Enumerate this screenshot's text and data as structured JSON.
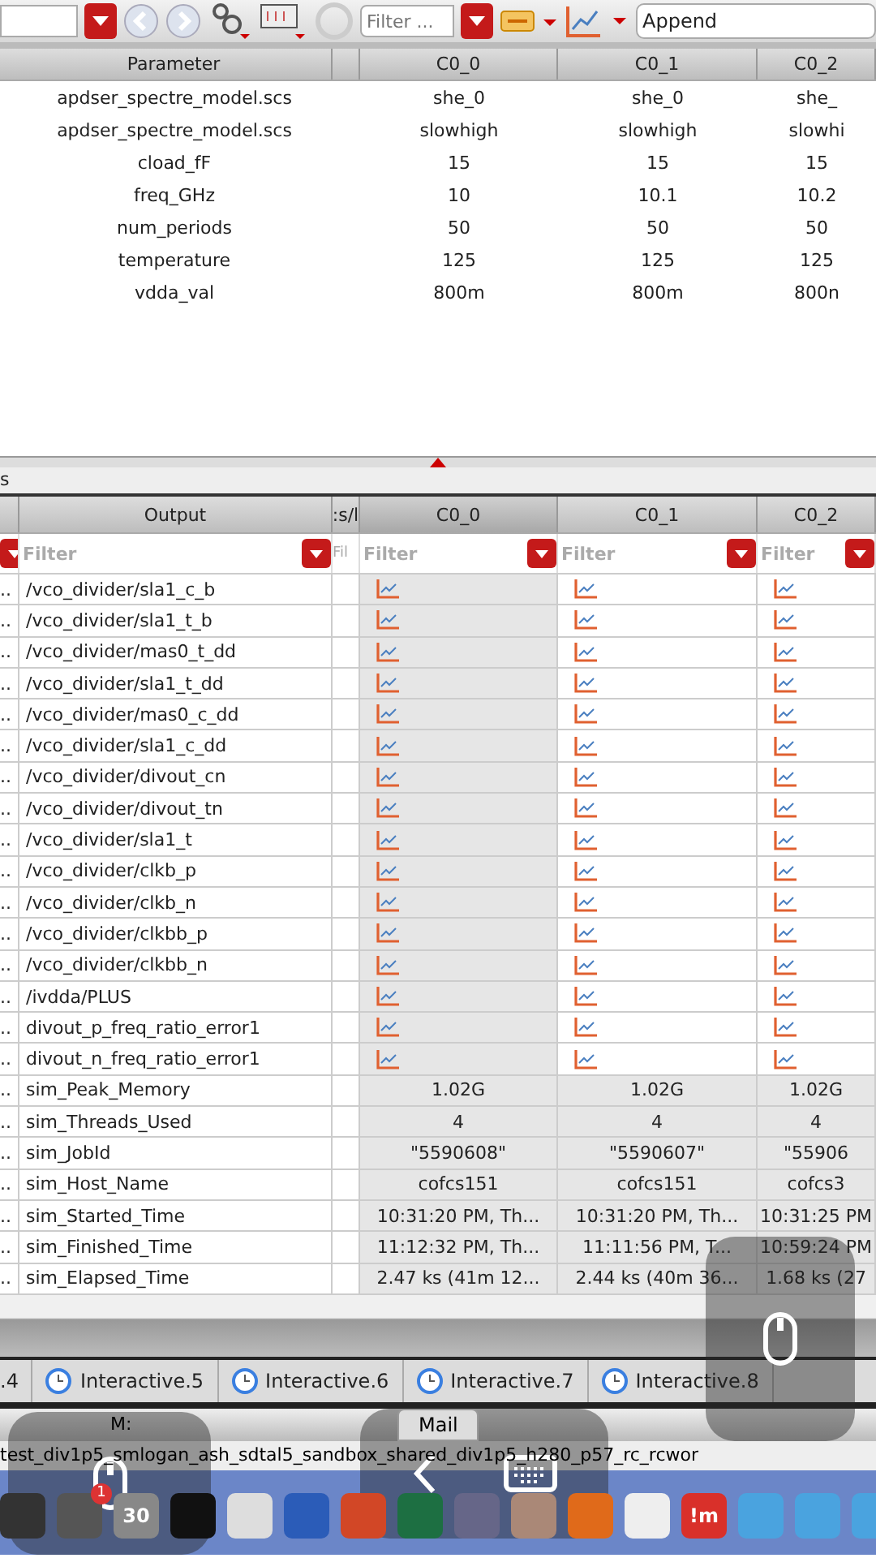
{
  "toolbar": {
    "filter": {
      "placeholder": "Filter ..."
    },
    "mode_field": {
      "value": "Append"
    }
  },
  "parameter_table": {
    "columns": [
      "Parameter",
      "C0_0",
      "C0_1",
      "C0_2"
    ],
    "rows": [
      {
        "name": "apdser_spectre_model.scs",
        "values": [
          "she_0",
          "she_0",
          "she_"
        ]
      },
      {
        "name": "apdser_spectre_model.scs",
        "values": [
          "slowhigh",
          "slowhigh",
          "slowhi"
        ]
      },
      {
        "name": "cload_fF",
        "values": [
          "15",
          "15",
          "15"
        ]
      },
      {
        "name": "freq_GHz",
        "values": [
          "10",
          "10.1",
          "10.2"
        ]
      },
      {
        "name": "num_periods",
        "values": [
          "50",
          "50",
          "50"
        ]
      },
      {
        "name": "temperature",
        "values": [
          "125",
          "125",
          "125"
        ]
      },
      {
        "name": "vdda_val",
        "values": [
          "800m",
          "800m",
          "800n"
        ]
      }
    ]
  },
  "pane_label": "s",
  "output_table": {
    "columns": [
      {
        "label": "Output",
        "selected": false
      },
      {
        "label": ":s/l",
        "selected": false
      },
      {
        "label": "C0_0",
        "selected": true
      },
      {
        "label": "C0_1",
        "selected": false
      },
      {
        "label": "C0_2",
        "selected": false
      }
    ],
    "filters": [
      {
        "placeholder": "Filter"
      },
      {
        "placeholder": "Fil"
      },
      {
        "placeholder": "Filter"
      },
      {
        "placeholder": "Filter"
      },
      {
        "placeholder": "Filter"
      }
    ],
    "rows": [
      {
        "lead": "..",
        "name": "/vco_divider/sla1_c_b",
        "kind": "waveform"
      },
      {
        "lead": "..",
        "name": "/vco_divider/sla1_t_b",
        "kind": "waveform"
      },
      {
        "lead": "..",
        "name": "/vco_divider/mas0_t_dd",
        "kind": "waveform"
      },
      {
        "lead": "..",
        "name": "/vco_divider/sla1_t_dd",
        "kind": "waveform"
      },
      {
        "lead": "..",
        "name": "/vco_divider/mas0_c_dd",
        "kind": "waveform"
      },
      {
        "lead": "..",
        "name": "/vco_divider/sla1_c_dd",
        "kind": "waveform"
      },
      {
        "lead": "..",
        "name": "/vco_divider/divout_cn",
        "kind": "waveform"
      },
      {
        "lead": "..",
        "name": "/vco_divider/divout_tn",
        "kind": "waveform"
      },
      {
        "lead": "..",
        "name": "/vco_divider/sla1_t",
        "kind": "waveform"
      },
      {
        "lead": "..",
        "name": "/vco_divider/clkb_p",
        "kind": "waveform"
      },
      {
        "lead": "..",
        "name": "/vco_divider/clkb_n",
        "kind": "waveform"
      },
      {
        "lead": "..",
        "name": "/vco_divider/clkbb_p",
        "kind": "waveform"
      },
      {
        "lead": "..",
        "name": "/vco_divider/clkbb_n",
        "kind": "waveform"
      },
      {
        "lead": "..",
        "name": "/ivdda/PLUS",
        "kind": "waveform"
      },
      {
        "lead": "..",
        "name": "divout_p_freq_ratio_error1",
        "kind": "waveform"
      },
      {
        "lead": "..",
        "name": "divout_n_freq_ratio_error1",
        "kind": "waveform"
      },
      {
        "lead": "..",
        "name": "sim_Peak_Memory",
        "kind": "scalar",
        "values": [
          "1.02G",
          "1.02G",
          "1.02G"
        ]
      },
      {
        "lead": "..",
        "name": "sim_Threads_Used",
        "kind": "scalar",
        "values": [
          "4",
          "4",
          "4"
        ]
      },
      {
        "lead": "..",
        "name": "sim_JobId",
        "kind": "scalar",
        "values": [
          "\"5590608\"",
          "\"5590607\"",
          "\"55906"
        ]
      },
      {
        "lead": "..",
        "name": "sim_Host_Name",
        "kind": "scalar",
        "values": [
          "cofcs151",
          "cofcs151",
          "cofcs3"
        ]
      },
      {
        "lead": "..",
        "name": "sim_Started_Time",
        "kind": "scalar",
        "values": [
          "10:31:20 PM, Th...",
          "10:31:20 PM, Th...",
          "10:31:25 PM"
        ]
      },
      {
        "lead": "..",
        "name": "sim_Finished_Time",
        "kind": "scalar",
        "values": [
          "11:12:32 PM, Th...",
          "11:11:56 PM, T...",
          "10:59:24 PM"
        ]
      },
      {
        "lead": "..",
        "name": "sim_Elapsed_Time",
        "kind": "scalar",
        "values": [
          "2.47 ks (41m  12...",
          "2.44 ks (40m  36...",
          "1.68 ks (27"
        ]
      }
    ]
  },
  "history_tabs": [
    {
      "label": ".4",
      "selected": false,
      "icon": false
    },
    {
      "label": "Interactive.5",
      "selected": false,
      "icon": true
    },
    {
      "label": "Interactive.6",
      "selected": false,
      "icon": true
    },
    {
      "label": "Interactive.7",
      "selected": false,
      "icon": true
    },
    {
      "label": "Interactive.8",
      "selected": false,
      "icon": true
    }
  ],
  "taskbar": {
    "left_label": "M:",
    "mail_button": "Mail",
    "path": "test_div1p5_smlogan_ash_sdtal5_sandbox_shared_div1p5_h280_p57_rc_rcwor"
  },
  "dock": [
    {
      "kind": "tools"
    },
    {
      "kind": "settings",
      "badge": "1"
    },
    {
      "kind": "calendar",
      "label": "30"
    },
    {
      "kind": "terminal"
    },
    {
      "kind": "editor"
    },
    {
      "kind": "word"
    },
    {
      "kind": "powerpoint"
    },
    {
      "kind": "excel"
    },
    {
      "kind": "viewer"
    },
    {
      "kind": "home"
    },
    {
      "kind": "browser"
    },
    {
      "kind": "screenshot"
    },
    {
      "kind": "app",
      "label": "!m"
    },
    {
      "kind": "folder"
    },
    {
      "kind": "folder"
    },
    {
      "kind": "folder"
    }
  ]
}
